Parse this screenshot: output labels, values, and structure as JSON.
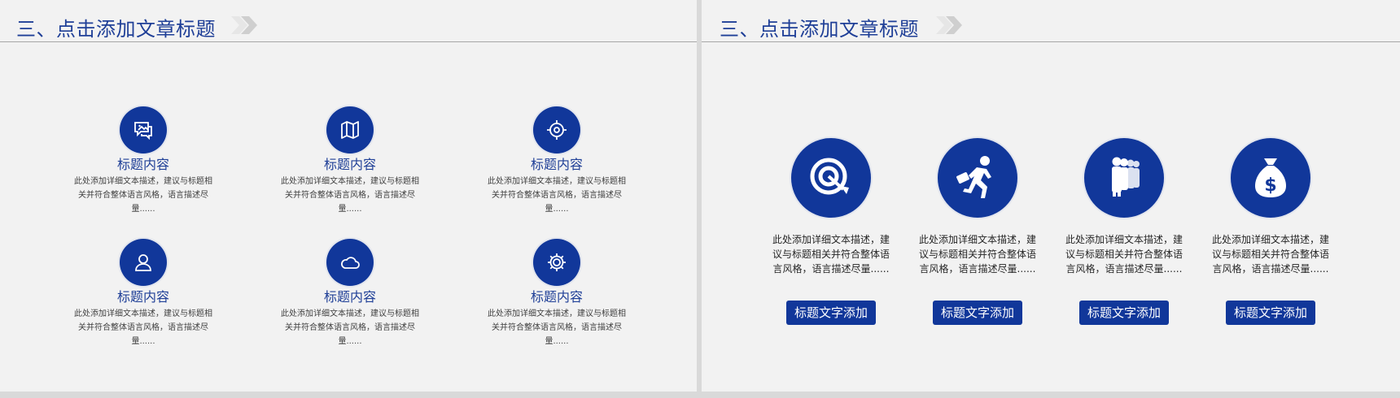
{
  "colors": {
    "accent": "#11379a",
    "title": "#1f3f97",
    "background": "#f2f2f2"
  },
  "left_slide": {
    "title": "三、点击添加文章标题",
    "items": [
      {
        "icon": "chat-image-icon",
        "title": "标题内容",
        "desc": "此处添加详细文本描述，建议与标题相关并符合整体语言风格，语言描述尽量......"
      },
      {
        "icon": "map-icon",
        "title": "标题内容",
        "desc": "此处添加详细文本描述，建议与标题相关并符合整体语言风格，语言描述尽量......"
      },
      {
        "icon": "target-scope-icon",
        "title": "标题内容",
        "desc": "此处添加详细文本描述，建议与标题相关并符合整体语言风格，语言描述尽量......"
      },
      {
        "icon": "user-icon",
        "title": "标题内容",
        "desc": "此处添加详细文本描述，建议与标题相关并符合整体语言风格，语言描述尽量......"
      },
      {
        "icon": "cloud-icon",
        "title": "标题内容",
        "desc": "此处添加详细文本描述，建议与标题相关并符合整体语言风格，语言描述尽量......"
      },
      {
        "icon": "gear-icon",
        "title": "标题内容",
        "desc": "此处添加详细文本描述，建议与标题相关并符合整体语言风格，语言描述尽量......"
      }
    ]
  },
  "right_slide": {
    "title": "三、点击添加文章标题",
    "items": [
      {
        "icon": "target-arrow-icon",
        "desc": "此处添加详细文本描述，建议与标题相关并符合整体语言风格，语言描述尽量......",
        "button": "标题文字添加"
      },
      {
        "icon": "running-man-briefcase-icon",
        "desc": "此处添加详细文本描述，建议与标题相关并符合整体语言风格，语言描述尽量......",
        "button": "标题文字添加"
      },
      {
        "icon": "team-people-icon",
        "desc": "此处添加详细文本描述，建议与标题相关并符合整体语言风格，语言描述尽量......",
        "button": "标题文字添加"
      },
      {
        "icon": "money-bag-icon",
        "desc": "此处添加详细文本描述，建议与标题相关并符合整体语言风格，语言描述尽量......",
        "button": "标题文字添加"
      }
    ]
  }
}
